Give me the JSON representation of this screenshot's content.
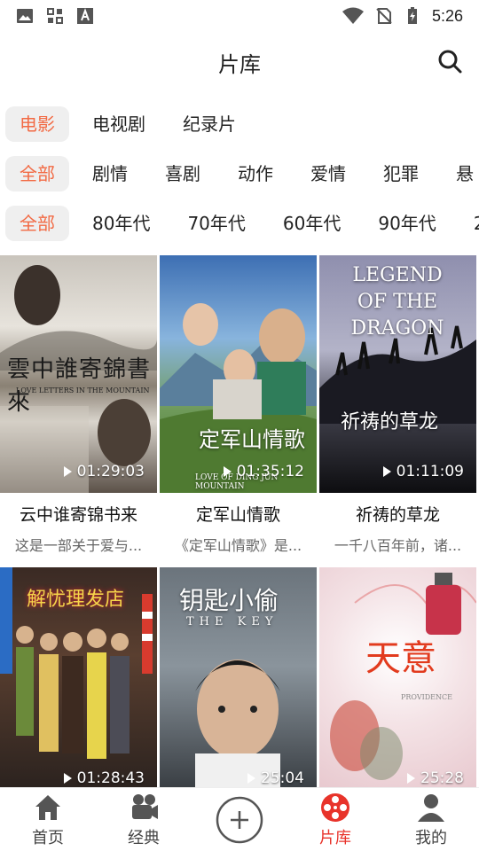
{
  "status": {
    "time": "5:26"
  },
  "header": {
    "title": "片库"
  },
  "filters": {
    "type": [
      "电影",
      "电视剧",
      "纪录片"
    ],
    "genre": [
      "全部",
      "剧情",
      "喜剧",
      "动作",
      "爱情",
      "犯罪",
      "悬"
    ],
    "era": [
      "全部",
      "80年代",
      "70年代",
      "60年代",
      "90年代",
      "2"
    ]
  },
  "movies": [
    {
      "title": "云中谁寄锦书来",
      "desc": "这是一部关于爱与...",
      "duration": "01:29:03",
      "poster_text": "雲中誰寄錦書來",
      "poster_sub": "LOVE LETTERS IN THE MOUNTAIN"
    },
    {
      "title": "定军山情歌",
      "desc": "《定军山情歌》是...",
      "duration": "01:35:12",
      "poster_text": "定军山情歌",
      "poster_sub": "LOVE OF DING JUN MOUNTAIN"
    },
    {
      "title": "祈祷的草龙",
      "desc": "一千八百年前，诸...",
      "duration": "01:11:09",
      "poster_text": "祈祷的草龙",
      "poster_sub": "LEGEND OF THE DRAGON"
    },
    {
      "title": "",
      "desc": "",
      "duration": "01:28:43",
      "poster_text": "解忧理发店",
      "poster_sub": ""
    },
    {
      "title": "",
      "desc": "",
      "duration": "25:04",
      "poster_text": "钥匙小偷",
      "poster_sub": "THE KEY"
    },
    {
      "title": "",
      "desc": "",
      "duration": "25:28",
      "poster_text": "天意",
      "poster_sub": "PROVIDENCE"
    }
  ],
  "tabs": [
    {
      "label": "首页",
      "icon": "home-icon"
    },
    {
      "label": "经典",
      "icon": "camera-icon"
    },
    {
      "label": "",
      "icon": "plus-icon"
    },
    {
      "label": "片库",
      "icon": "film-reel-icon"
    },
    {
      "label": "我的",
      "icon": "user-icon"
    }
  ],
  "colors": {
    "accent": "#f26a44",
    "tab_active": "#e8332a"
  }
}
